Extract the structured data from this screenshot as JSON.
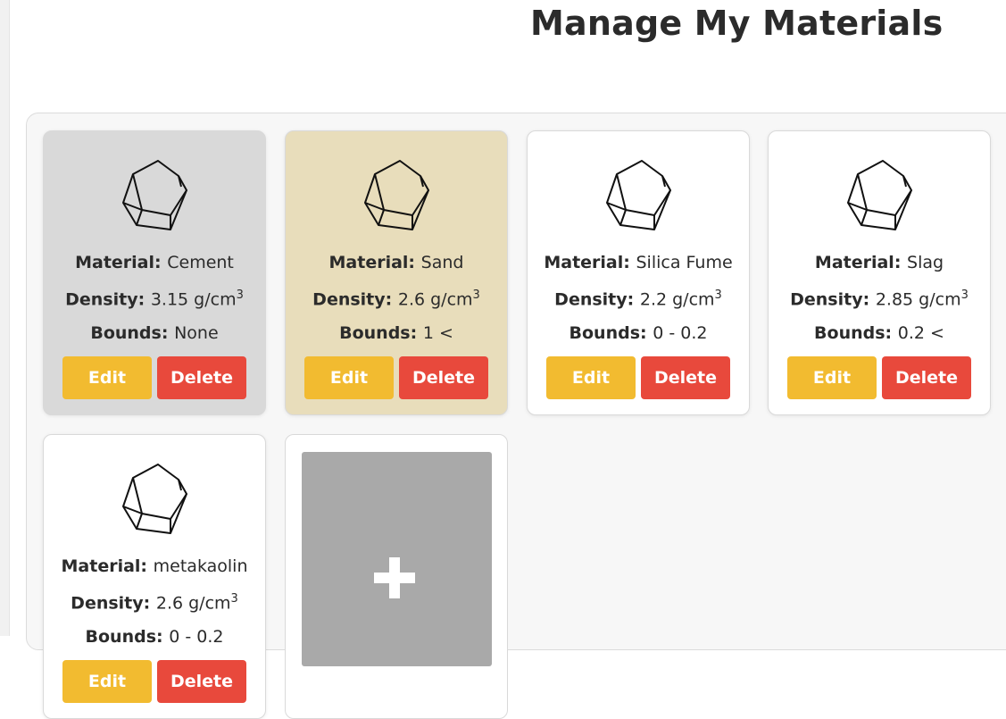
{
  "page": {
    "title": "Manage My Materials"
  },
  "labels": {
    "material": "Material:",
    "density": "Density:",
    "bounds": "Bounds:",
    "edit": "Edit",
    "delete": "Delete"
  },
  "materials": [
    {
      "name": "Cement",
      "density": "3.15 g/cm",
      "density_exp": "3",
      "bounds": "None",
      "card_color": "#d9d9d9"
    },
    {
      "name": "Sand",
      "density": "2.6 g/cm",
      "density_exp": "3",
      "bounds": "1 <",
      "card_color": "#e8ddbb"
    },
    {
      "name": "Silica Fume",
      "density": "2.2 g/cm",
      "density_exp": "3",
      "bounds": "0 - 0.2",
      "card_color": "#ffffff"
    },
    {
      "name": "Slag",
      "density": "2.85 g/cm",
      "density_exp": "3",
      "bounds": "0.2 <",
      "card_color": "#ffffff"
    },
    {
      "name": "metakaolin",
      "density": "2.6 g/cm",
      "density_exp": "3",
      "bounds": "0 - 0.2",
      "card_color": "#ffffff"
    }
  ],
  "add_card": {
    "icon": "plus-icon"
  },
  "colors": {
    "edit_button": "#f2bb30",
    "delete_button": "#e8493c",
    "add_tile": "#a9a9a9"
  },
  "icons": {
    "material": "crystal-icon"
  }
}
